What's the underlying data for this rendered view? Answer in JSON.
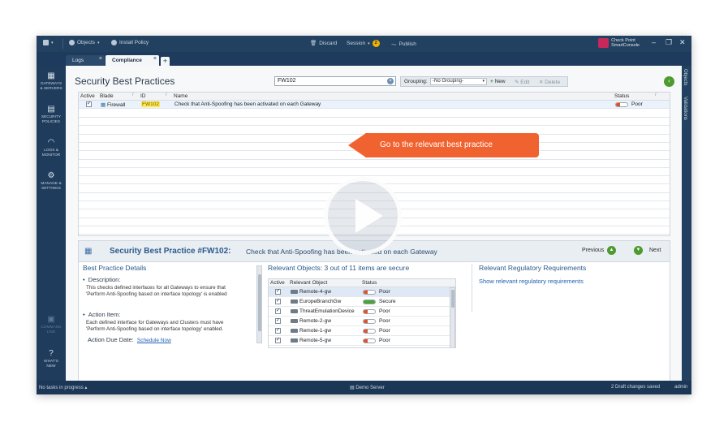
{
  "topbar": {
    "objects_label": "Objects",
    "install_policy_label": "Install Policy",
    "discard_label": "Discard",
    "session_label": "Session",
    "session_count": "2",
    "publish_label": "Publish",
    "brand_line1": "Check Point",
    "brand_line2": "SmartConsole"
  },
  "tabs": [
    {
      "label": "Logs"
    },
    {
      "label": "Compliance"
    }
  ],
  "leftnav": [
    {
      "label1": "GATEWAYS",
      "label2": "& SERVERS"
    },
    {
      "label1": "SECURITY",
      "label2": "POLICIES"
    },
    {
      "label1": "LOGS &",
      "label2": "MONITOR"
    },
    {
      "label1": "MANAGE &",
      "label2": "SETTINGS"
    },
    {
      "label1": "COMMAND",
      "label2": "LINE"
    },
    {
      "label1": "WHAT'S",
      "label2": "NEW"
    }
  ],
  "right_tabs": {
    "objects": "Objects",
    "validations": "Validations"
  },
  "page": {
    "title": "Security Best Practices",
    "search_value": "FW102",
    "grouping_label": "Grouping:",
    "grouping_value": "-No Grouping-",
    "new_label": "New",
    "edit_label": "Edit",
    "delete_label": "Delete"
  },
  "grid": {
    "headers": {
      "active": "Active",
      "blade": "Blade",
      "id": "ID",
      "name": "Name",
      "status": "Status"
    },
    "rows": [
      {
        "active": true,
        "blade": "Firewall",
        "id": "FW102",
        "name": "Check that Anti-Spoofing has been activated on each Gateway",
        "status": "Poor",
        "status_level": 0.35
      }
    ]
  },
  "callout": {
    "text": "Go to the relevant best practice"
  },
  "details": {
    "title": "Security Best Practice #FW102:",
    "description": "Check that Anti-Spoofing has been activated on each Gateway",
    "previous_label": "Previous",
    "next_label": "Next",
    "section_title": "Best Practice Details",
    "description_label": "Description:",
    "description_text_1": "This checks defined interfaces for all Gateways to ensure that",
    "description_text_2": "'Perform Anti-Spoofing based on interface topology' is enabled",
    "action_item_label": "Action Item:",
    "action_text_1": "Each defined interface for Gateways and Clusters must have",
    "action_text_2": "'Perform Anti-Spoofing based on interface topology' enabled.",
    "due_date_label": "Action Due Date:",
    "schedule_link": "Schedule Now",
    "relevant_objects_title": "Relevant Objects: 3 out of 11 items are secure",
    "objects_headers": {
      "active": "Active",
      "object": "Relevant Object",
      "status": "Status"
    },
    "objects": [
      {
        "active": true,
        "name": "Remote-4-gw",
        "status": "Poor",
        "secure": false
      },
      {
        "active": true,
        "name": "EuropeBranchGw",
        "status": "Secure",
        "secure": true
      },
      {
        "active": true,
        "name": "ThreatEmulationDevice",
        "status": "Poor",
        "secure": false
      },
      {
        "active": true,
        "name": "Remote-2-gw",
        "status": "Poor",
        "secure": false
      },
      {
        "active": true,
        "name": "Remote-1-gw",
        "status": "Poor",
        "secure": false
      },
      {
        "active": true,
        "name": "Remote-5-gw",
        "status": "Poor",
        "secure": false
      }
    ],
    "regulatory_title": "Relevant Regulatory Requirements",
    "regulatory_link": "Show relevant regulatory requirements"
  },
  "statusbar": {
    "tasks": "No tasks in progress",
    "server": "Demo Server",
    "changes": "2 Draft changes saved",
    "user": "admin"
  },
  "colors": {
    "chrome": "#1e3a5c",
    "callout": "#f0622f",
    "link": "#1f5fb0",
    "poor": "#e0522c",
    "secure": "#4aa43a"
  }
}
